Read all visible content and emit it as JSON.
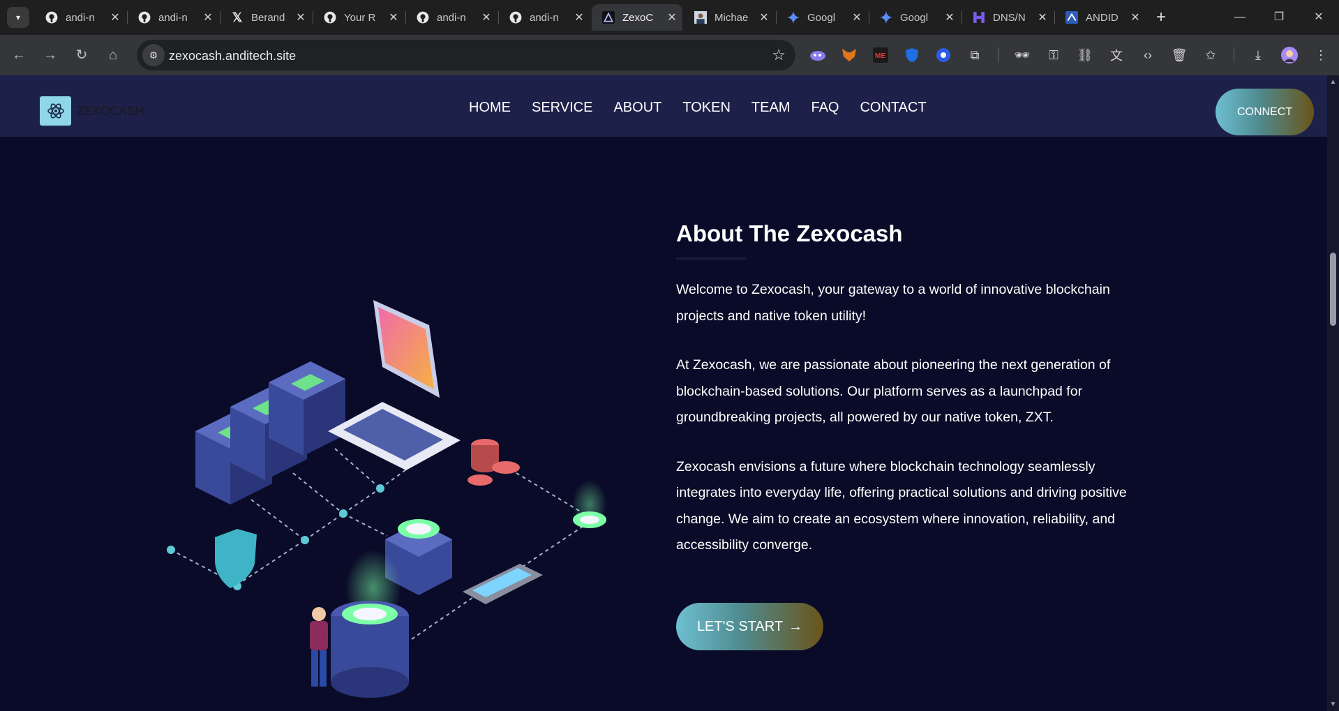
{
  "browser": {
    "tabs": [
      {
        "title": "andi-n",
        "icon": "github-icon"
      },
      {
        "title": "andi-n",
        "icon": "github-icon"
      },
      {
        "title": "Berand",
        "icon": "x-icon"
      },
      {
        "title": "Your R",
        "icon": "github-icon"
      },
      {
        "title": "andi-n",
        "icon": "github-icon"
      },
      {
        "title": "andi-n",
        "icon": "github-icon"
      },
      {
        "title": "ZexoC",
        "icon": "zexo-icon",
        "active": true
      },
      {
        "title": "Michae",
        "icon": "avatar-icon"
      },
      {
        "title": "Googl",
        "icon": "gemini-icon"
      },
      {
        "title": "Googl",
        "icon": "gemini-icon"
      },
      {
        "title": "DNS/N",
        "icon": "dns-icon"
      },
      {
        "title": "ANDID",
        "icon": "andid-icon"
      }
    ],
    "url": "zexocash.anditech.site"
  },
  "site": {
    "logo_text": "ZEXOCASH",
    "nav": [
      "HOME",
      "SERVICE",
      "ABOUT",
      "TOKEN",
      "TEAM",
      "FAQ",
      "CONTACT"
    ],
    "connect_label": "CONNECT"
  },
  "about": {
    "title": "About The Zexocash",
    "paragraphs": [
      "Welcome to Zexocash, your gateway to a world of innovative blockchain projects and native token utility!",
      "At Zexocash, we are passionate about pioneering the next generation of blockchain-based solutions. Our platform serves as a launchpad for groundbreaking projects, all powered by our native token, ZXT.",
      "Zexocash envisions a future where blockchain technology seamlessly integrates into everyday life, offering practical solutions and driving positive change. We aim to create an ecosystem where innovation, reliability, and accessibility converge."
    ],
    "start_label": "LET'S START",
    "start_arrow": "→"
  },
  "colors": {
    "page_bg": "#0a0b28",
    "header_bg": "#1d2149",
    "button_gradient_start": "#6dbfd0",
    "button_gradient_end": "#6b5418"
  }
}
